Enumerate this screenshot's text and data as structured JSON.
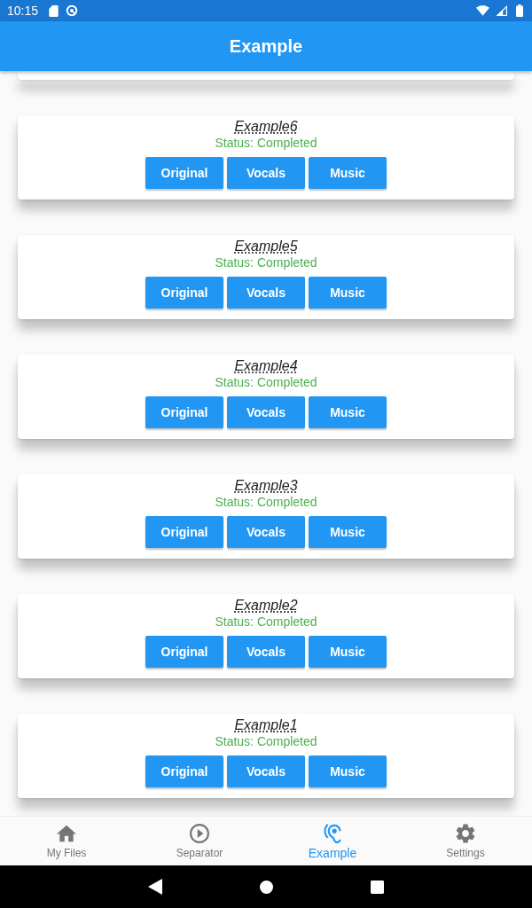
{
  "status_bar": {
    "time": "10:15"
  },
  "app_bar": {
    "title": "Example"
  },
  "cards": [
    {
      "title": "Example6",
      "status": "Status: Completed",
      "buttons": [
        "Original",
        "Vocals",
        "Music"
      ]
    },
    {
      "title": "Example5",
      "status": "Status: Completed",
      "buttons": [
        "Original",
        "Vocals",
        "Music"
      ]
    },
    {
      "title": "Example4",
      "status": "Status: Completed",
      "buttons": [
        "Original",
        "Vocals",
        "Music"
      ]
    },
    {
      "title": "Example3",
      "status": "Status: Completed",
      "buttons": [
        "Original",
        "Vocals",
        "Music"
      ]
    },
    {
      "title": "Example2",
      "status": "Status: Completed",
      "buttons": [
        "Original",
        "Vocals",
        "Music"
      ]
    },
    {
      "title": "Example1",
      "status": "Status: Completed",
      "buttons": [
        "Original",
        "Vocals",
        "Music"
      ]
    }
  ],
  "bottom_nav": [
    {
      "label": "My Files",
      "selected": false
    },
    {
      "label": "Separator",
      "selected": false
    },
    {
      "label": "Example",
      "selected": true
    },
    {
      "label": "Settings",
      "selected": false
    }
  ]
}
